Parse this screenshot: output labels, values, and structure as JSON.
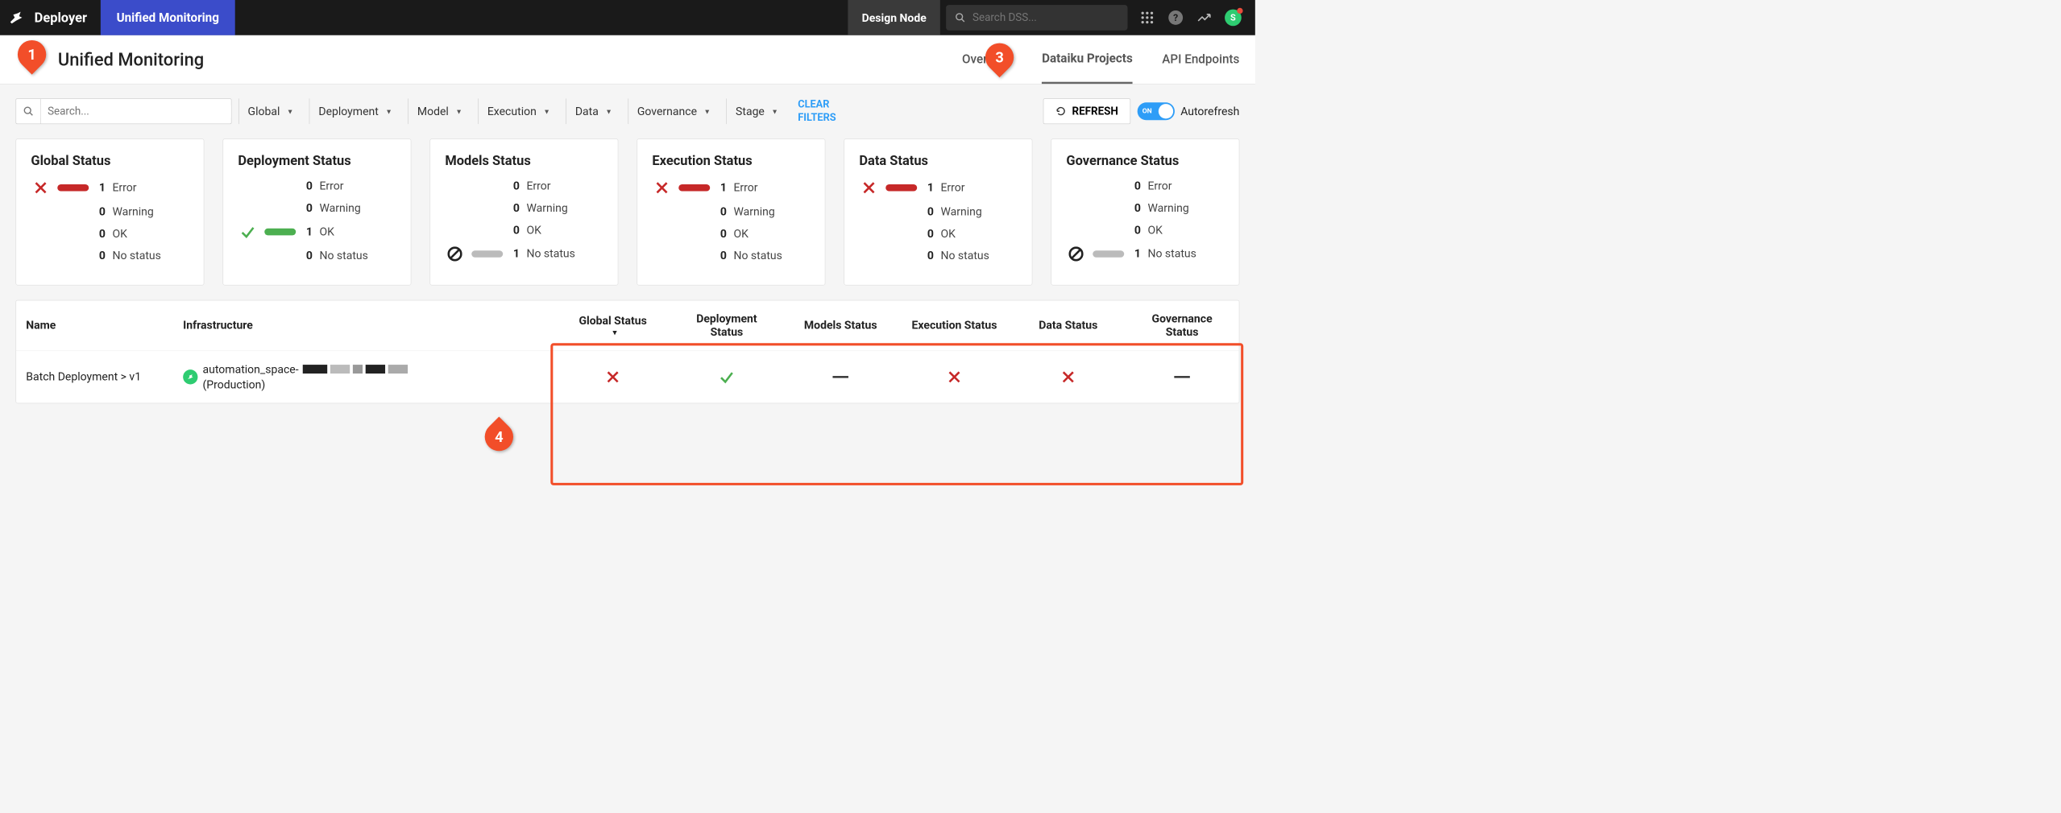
{
  "topbar": {
    "brand": "Deployer",
    "active_tab": "Unified Monitoring",
    "node_label": "Design Node",
    "search_placeholder": "Search DSS...",
    "avatar_letter": "S"
  },
  "subhead": {
    "title": "Unified Monitoring",
    "tabs": {
      "overview": "Overview",
      "projects": "Dataiku Projects",
      "api": "API Endpoints"
    }
  },
  "filterbar": {
    "search_placeholder": "Search...",
    "drops": {
      "global": "Global",
      "deployment": "Deployment",
      "model": "Model",
      "execution": "Execution",
      "data": "Data",
      "governance": "Governance",
      "stage": "Stage"
    },
    "clear": "CLEAR FILTERS",
    "refresh": "REFRESH",
    "autorefresh": "Autorefresh",
    "toggle_on": "ON"
  },
  "cards": [
    {
      "title": "Global Status",
      "rows": [
        {
          "count": 1,
          "label": "Error",
          "icon": "x",
          "bar": "red"
        },
        {
          "count": 0,
          "label": "Warning"
        },
        {
          "count": 0,
          "label": "OK"
        },
        {
          "count": 0,
          "label": "No status"
        }
      ]
    },
    {
      "title": "Deployment Status",
      "rows": [
        {
          "count": 0,
          "label": "Error"
        },
        {
          "count": 0,
          "label": "Warning"
        },
        {
          "count": 1,
          "label": "OK",
          "icon": "check",
          "bar": "green"
        },
        {
          "count": 0,
          "label": "No status"
        }
      ]
    },
    {
      "title": "Models Status",
      "rows": [
        {
          "count": 0,
          "label": "Error"
        },
        {
          "count": 0,
          "label": "Warning"
        },
        {
          "count": 0,
          "label": "OK"
        },
        {
          "count": 1,
          "label": "No status",
          "icon": "empty",
          "bar": "grey"
        }
      ]
    },
    {
      "title": "Execution Status",
      "rows": [
        {
          "count": 1,
          "label": "Error",
          "icon": "x",
          "bar": "red"
        },
        {
          "count": 0,
          "label": "Warning"
        },
        {
          "count": 0,
          "label": "OK"
        },
        {
          "count": 0,
          "label": "No status"
        }
      ]
    },
    {
      "title": "Data Status",
      "rows": [
        {
          "count": 1,
          "label": "Error",
          "icon": "x",
          "bar": "red"
        },
        {
          "count": 0,
          "label": "Warning"
        },
        {
          "count": 0,
          "label": "OK"
        },
        {
          "count": 0,
          "label": "No status"
        }
      ]
    },
    {
      "title": "Governance Status",
      "rows": [
        {
          "count": 0,
          "label": "Error"
        },
        {
          "count": 0,
          "label": "Warning"
        },
        {
          "count": 0,
          "label": "OK"
        },
        {
          "count": 1,
          "label": "No status",
          "icon": "empty",
          "bar": "grey"
        }
      ]
    }
  ],
  "table": {
    "headers": {
      "name": "Name",
      "infra": "Infrastructure",
      "global": "Global Status",
      "deployment": "Deployment Status",
      "models": "Models Status",
      "execution": "Execution Status",
      "data": "Data Status",
      "governance": "Governance Status"
    },
    "row": {
      "name": "Batch Deployment > v1",
      "infra_prefix": "automation_space-",
      "infra_suffix": "(Production)",
      "statuses": {
        "global": "x",
        "deployment": "check",
        "models": "dash",
        "execution": "x",
        "data": "x",
        "governance": "dash"
      }
    }
  },
  "callouts": {
    "c1": "1",
    "c3": "3",
    "c4": "4"
  }
}
